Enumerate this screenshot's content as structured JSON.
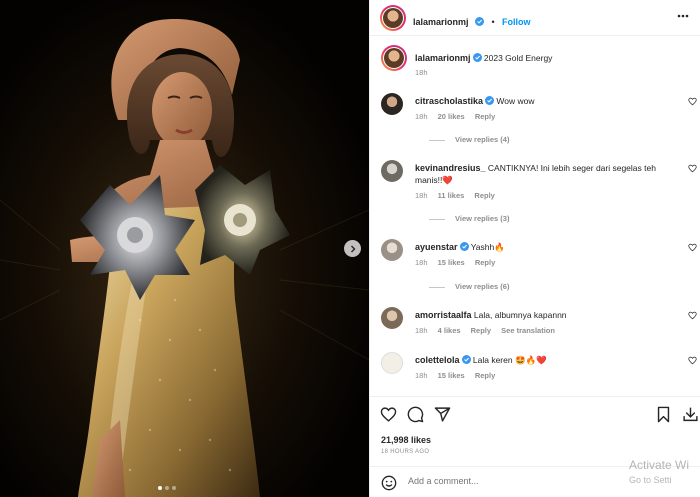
{
  "colors": {
    "accent": "#0095f6",
    "verified": "#3897f0",
    "story_ring": "#e1306c"
  },
  "media": {
    "carousel_dots": 3,
    "active_dot": 1,
    "next_icon": "chevron-right-icon"
  },
  "header": {
    "username": "lalamarionmj",
    "follow_label": "Follow",
    "separator": "•"
  },
  "caption": {
    "username": "lalamarionmj",
    "text": "2023 Gold Energy",
    "time": "18h"
  },
  "comments": [
    {
      "username": "citrascholastika",
      "verified": true,
      "text": "Wow wow",
      "time": "18h",
      "likes": "20 likes",
      "reply": "Reply",
      "view_replies": "View replies (4)"
    },
    {
      "username": "kevinandresius_",
      "verified": false,
      "text": "CANTIKNYA! Ini lebih seger dari segelas teh manis!!❤️",
      "time": "18h",
      "likes": "11 likes",
      "reply": "Reply",
      "view_replies": "View replies (3)"
    },
    {
      "username": "ayuenstar",
      "verified": true,
      "text": "Yashh🔥",
      "time": "18h",
      "likes": "15 likes",
      "reply": "Reply",
      "view_replies": "View replies (6)"
    },
    {
      "username": "amorristaalfa",
      "verified": false,
      "text": "Lala, albumnya kapannn",
      "time": "18h",
      "likes": "4 likes",
      "reply": "Reply",
      "see_translation": "See translation"
    },
    {
      "username": "colettelola",
      "verified": true,
      "text": "Lala keren 🤩🔥❤️",
      "time": "18h",
      "likes": "15 likes",
      "reply": "Reply"
    }
  ],
  "actions": {
    "likes": "21,998 likes",
    "time_ago": "18 HOURS AGO"
  },
  "add_comment": {
    "placeholder": "Add a comment..."
  },
  "watermark": {
    "line1": "Activate Wi",
    "line2": "Go to Setti"
  }
}
